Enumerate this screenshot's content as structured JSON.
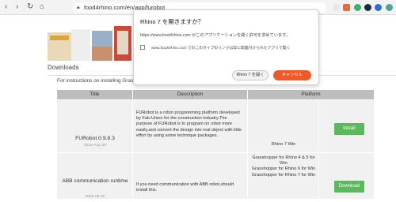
{
  "browser": {
    "back": "‹",
    "forward": "›",
    "reload": "↻",
    "home": "⌂",
    "url": "food4rhino.com/en/app/furobot",
    "lock_icon": "lock-icon"
  },
  "page": {
    "section_title": "Downloads",
    "instructions": "For instructions on installing Grassh",
    "table": {
      "headers": [
        "Title",
        "Description",
        "Platform"
      ],
      "rows": [
        {
          "title": "FURobot 0.9.8.3",
          "date": "2023-Aug-25",
          "description": "FURobot is a robot programming platform developed by Fab-Union for the construction industry.The purpose of FURobot is to program on robot more easily,and convert the design into real object with little effort by using some technique packages.",
          "platform": "Rhino 7 Win",
          "button": "Install"
        },
        {
          "title": "ABB communication runtime",
          "date": "2020-05-06",
          "description": "If you need communication with ABB robot,should install this.",
          "platform": "Grasshopper for Rhino 4 & 5 for Win\nGrasshopper for Rhino 6 for Win\nGrasshopper for Rhino 7 for Win",
          "button": "Download"
        }
      ]
    }
  },
  "dialog": {
    "title": "Rhino 7 を開きますか？",
    "message": "https://www.food4rhino.com がこのアプリケーションを開く許可を求めています。",
    "checkbox_label": "www.food4rhino.com でのこのタイプのリンクは常に関連付けられたアプリで開く",
    "open_button": "Rhino 7 を開く",
    "cancel_button": "キャンセル"
  },
  "colors": {
    "accent_cancel": "#f0592a",
    "button_green": "#5cb85c",
    "table_header": "#bdbdbd"
  }
}
